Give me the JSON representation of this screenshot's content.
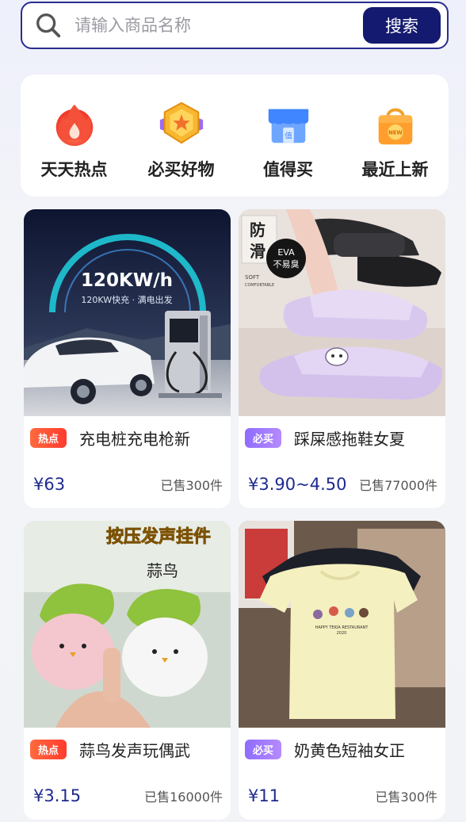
{
  "search": {
    "placeholder": "请输入商品名称",
    "button_label": "搜索"
  },
  "categories": [
    {
      "label": "天天热点",
      "icon": "flame-icon"
    },
    {
      "label": "必买好物",
      "icon": "star-badge-icon"
    },
    {
      "label": "值得买",
      "icon": "storefront-icon"
    },
    {
      "label": "最近上新",
      "icon": "new-bag-icon"
    }
  ],
  "products": [
    {
      "tag": "热点",
      "title": "充电桩充电枪新",
      "price": "¥63",
      "sold": "已售300件",
      "image_text": {
        "power": "120KW/h",
        "subtitle": "120KW快充 · 满电出发"
      }
    },
    {
      "tag": "必买",
      "title": "踩屎感拖鞋女夏",
      "price": "¥3.90~4.50",
      "sold": "已售77000件",
      "image_text": {
        "badge_line1": "防",
        "badge_line2": "滑",
        "eva_line1": "EVA",
        "eva_line2": "不易臭",
        "soft": "SOFT",
        "comfortable": "COMFORTABLE"
      }
    },
    {
      "tag": "热点",
      "title": "蒜鸟发声玩偶武",
      "price": "¥3.15",
      "sold": "已售16000件",
      "image_text": {
        "banner": "按压发声挂件",
        "name": "蒜鸟"
      }
    },
    {
      "tag": "必买",
      "title": "奶黄色短袖女正",
      "price": "¥11",
      "sold": "已售300件",
      "image_text": {
        "shirt_line": "HAPPY TEKIA RESTAURANT",
        "year": "2020"
      }
    }
  ],
  "colors": {
    "accent": "#141a6f",
    "price": "#1e2a8f",
    "hot_tag": "#ff3b2f",
    "must_tag": "#9a74ff"
  }
}
